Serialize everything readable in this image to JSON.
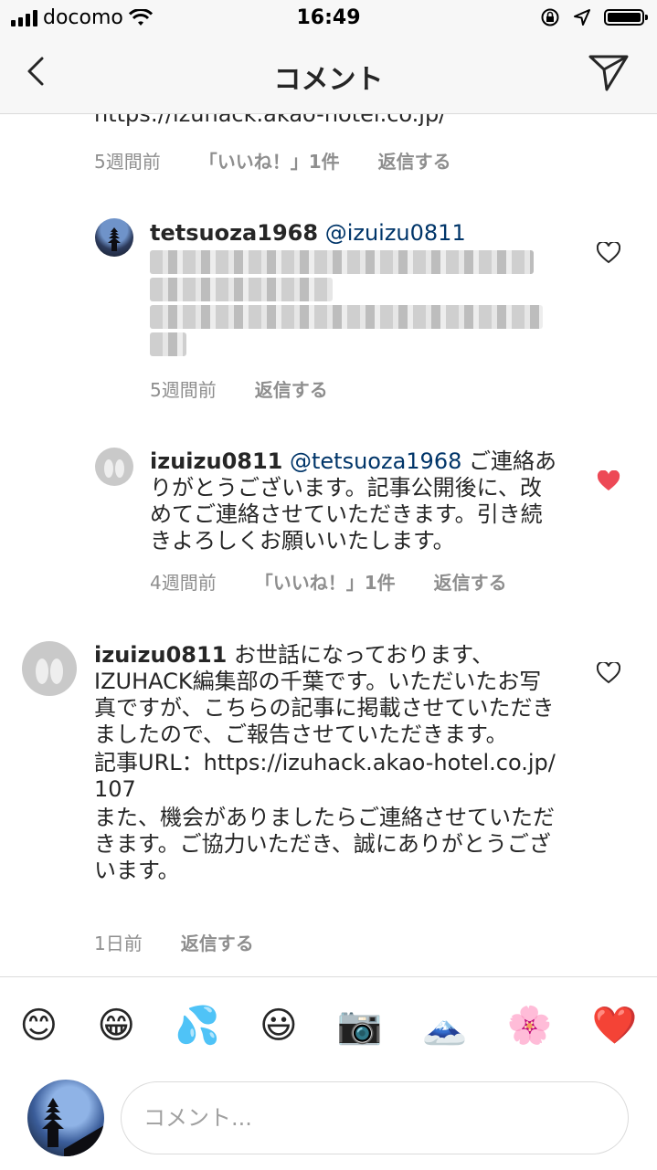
{
  "status_bar": {
    "carrier": "docomo",
    "time": "16:49"
  },
  "nav": {
    "title": "コメント"
  },
  "thread": {
    "cut_link": "https://izuhack.akao-hotel.co.jp/",
    "first_meta": {
      "time": "5週間前",
      "likes": "「いいね！」1件",
      "reply": "返信する"
    }
  },
  "comments": [
    {
      "username": "tetsuoza1968",
      "mention": "@izuizu0811",
      "text": "",
      "time": "5週間前",
      "reply": "返信する",
      "liked": false,
      "text_pixelated": true
    },
    {
      "username": "izuizu0811",
      "mention": "@tetsuoza1968",
      "text": "ご連絡ありがとうございます。記事公開後に、改めてご連絡させていただきます。引き続きよろしくお願いいたします。",
      "time": "4週間前",
      "likes": "「いいね！」1件",
      "reply": "返信する",
      "liked": true
    },
    {
      "username": "izuizu0811",
      "text_line1": "お世話になっております、IZUHACK編集部の千葉です。いただいたお写真ですが、こちらの記事に掲載させていただきましたので、ご報告させていただきます。",
      "text_line2": "記事URL：https://izuhack.akao-hotel.co.jp/107",
      "text_line3": "また、機会がありましたらご連絡させていただきます。ご協力いただき、誠にありがとうございます。",
      "time": "1日前",
      "reply": "返信する",
      "liked": false
    }
  ],
  "emoji_bar": [
    "😊",
    "😁",
    "💦",
    "😃",
    "📷",
    "🗻",
    "🌸",
    "❤️"
  ],
  "input": {
    "placeholder": "コメント..."
  },
  "colors": {
    "like_red": "#ed4956",
    "mention_blue": "#003569",
    "meta_gray": "#8e8e8e"
  }
}
